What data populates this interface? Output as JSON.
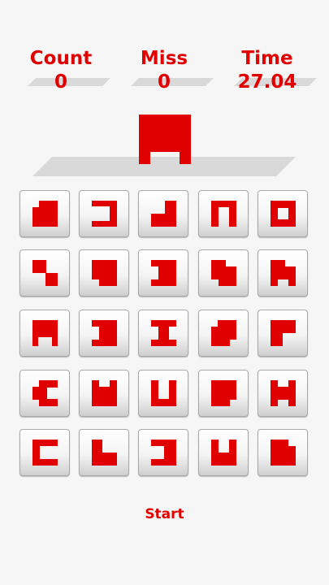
{
  "colors": {
    "accent": "#e00000",
    "shelf": "#d9d9d9"
  },
  "stats": {
    "count": {
      "label": "Count",
      "value": "0"
    },
    "miss": {
      "label": "Miss",
      "value": "0"
    },
    "time": {
      "label": "Time",
      "value": "27.04"
    }
  },
  "target": {
    "shape": "arch-large"
  },
  "tiles": [
    {
      "shape": "block-notch-top-left"
    },
    {
      "shape": "bracket-open-left"
    },
    {
      "shape": "l-shape-bottom"
    },
    {
      "shape": "arch-thin"
    },
    {
      "shape": "square-ring"
    },
    {
      "shape": "l-shape-top-right"
    },
    {
      "shape": "block-notch-bottom-left"
    },
    {
      "shape": "bracket-open-right"
    },
    {
      "shape": "block-notch-two-corners"
    },
    {
      "shape": "block-notches"
    },
    {
      "shape": "arch-short"
    },
    {
      "shape": "block-notch-left"
    },
    {
      "shape": "i-beam"
    },
    {
      "shape": "block-notch-corners"
    },
    {
      "shape": "l-shape-top-left"
    },
    {
      "shape": "c-shape-notched"
    },
    {
      "shape": "cup-notched"
    },
    {
      "shape": "u-shape"
    },
    {
      "shape": "block-notch-bottom-right"
    },
    {
      "shape": "block-notch-sides"
    },
    {
      "shape": "c-shape"
    },
    {
      "shape": "l-shape-big"
    },
    {
      "shape": "reverse-c"
    },
    {
      "shape": "u-notch-top"
    },
    {
      "shape": "block-notch-top-right"
    }
  ],
  "start": {
    "label": "Start"
  }
}
